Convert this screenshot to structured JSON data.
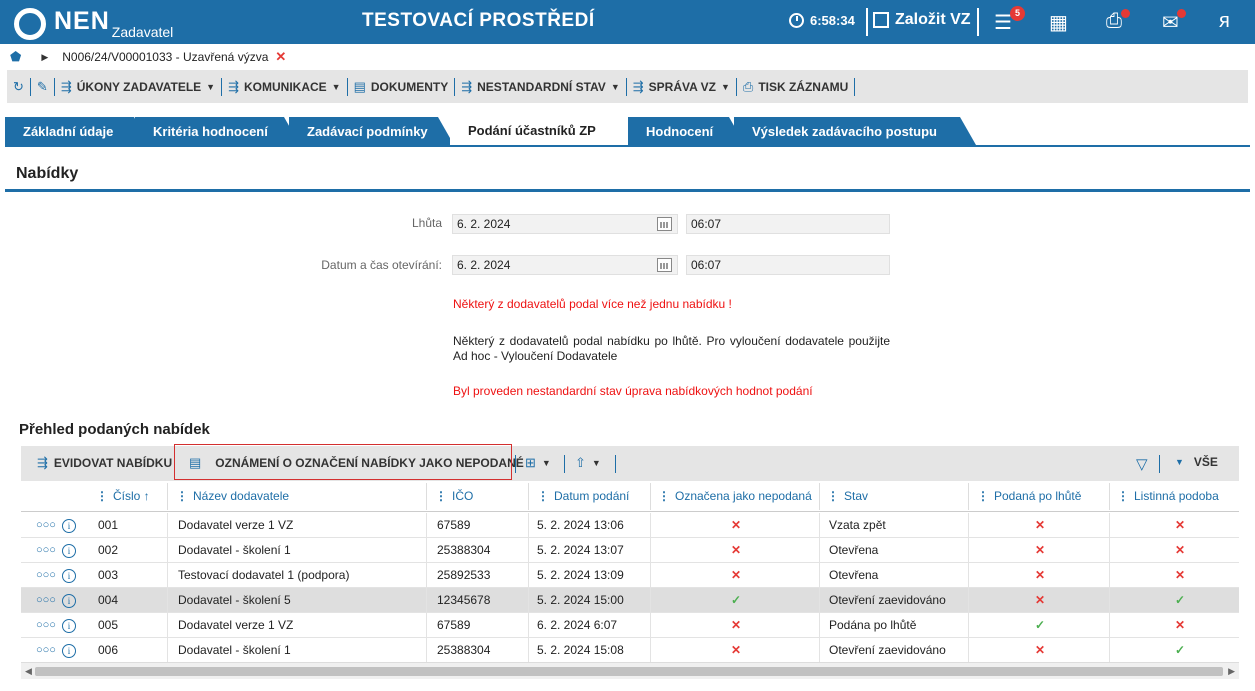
{
  "header": {
    "logo_text": "NEN",
    "logo_sub": "Zadavatel",
    "env_title": "TESTOVACÍ PROSTŘEDÍ",
    "clock": "6:58:34",
    "create_label": "Založit VZ",
    "menu_badge": "5"
  },
  "breadcrumb": {
    "path": "N006/24/V00001033 - Uzavřená výzva"
  },
  "toolbar": {
    "ukony": "ÚKONY ZADAVATELE",
    "komunikace": "KOMUNIKACE",
    "dokumenty": "DOKUMENTY",
    "nestandardni": "NESTANDARDNÍ STAV",
    "sprava": "SPRÁVA VZ",
    "tisk": "TISK ZÁZNAMU"
  },
  "tabs": [
    {
      "label": "Základní údaje"
    },
    {
      "label": "Kritéria hodnocení"
    },
    {
      "label": "Zadávací podmínky"
    },
    {
      "label": "Podání účastníků ZP"
    },
    {
      "label": "Hodnocení"
    },
    {
      "label": "Výsledek zadávacího postupu"
    }
  ],
  "section": {
    "title": "Nabídky",
    "lhuta_label": "Lhůta",
    "lhuta_date": "6. 2. 2024",
    "lhuta_time": "06:07",
    "otevreni_label": "Datum a čas otevírání:",
    "otevreni_date": "6. 2. 2024",
    "otevreni_time": "06:07",
    "msg1": "Některý z dodavatelů podal více než jednu nabídku !",
    "msg2": "Některý z dodavatelů podal nabídku po lhůtě. Pro vyloučení dodavatele použijte Ad hoc - Vyloučení Dodavatele",
    "msg3": "Byl proveden nestandardní stav úprava nabídkových hodnot podání"
  },
  "grid": {
    "title": "Přehled podaných nabídek",
    "evidovat": "EVIDOVAT NABÍDKU",
    "oznameni": "OZNÁMENÍ O OZNAČENÍ NABÍDKY JAKO NEPODANÉ",
    "vse": "VŠE",
    "columns": [
      "Číslo",
      "Název dodavatele",
      "IČO",
      "Datum podání",
      "Označena jako nepodaná",
      "Stav",
      "Podaná po lhůtě",
      "Listinná podoba"
    ],
    "rows": [
      {
        "cislo": "001",
        "nazev": "Dodavatel verze 1 VZ",
        "ico": "67589",
        "datum": "5. 2. 2024 13:06",
        "nepodana": "x",
        "stav": "Vzata zpět",
        "po_lhute": "x",
        "listinna": "x"
      },
      {
        "cislo": "002",
        "nazev": "Dodavatel - školení 1",
        "ico": "25388304",
        "datum": "5. 2. 2024 13:07",
        "nepodana": "x",
        "stav": "Otevřena",
        "po_lhute": "x",
        "listinna": "x"
      },
      {
        "cislo": "003",
        "nazev": "Testovací dodavatel 1 (podpora)",
        "ico": "25892533",
        "datum": "5. 2. 2024 13:09",
        "nepodana": "x",
        "stav": "Otevřena",
        "po_lhute": "x",
        "listinna": "x"
      },
      {
        "cislo": "004",
        "nazev": "Dodavatel - školení 5",
        "ico": "12345678",
        "datum": "5. 2. 2024 15:00",
        "nepodana": "check",
        "stav": "Otevření zaevidováno",
        "po_lhute": "x",
        "listinna": "check"
      },
      {
        "cislo": "005",
        "nazev": "Dodavatel verze 1 VZ",
        "ico": "67589",
        "datum": "6. 2. 2024 6:07",
        "nepodana": "x",
        "stav": "Podána po lhůtě",
        "po_lhute": "check",
        "listinna": "x"
      },
      {
        "cislo": "006",
        "nazev": "Dodavatel - školení 1",
        "ico": "25388304",
        "datum": "5. 2. 2024 15:08",
        "nepodana": "x",
        "stav": "Otevření zaevidováno",
        "po_lhute": "x",
        "listinna": "check"
      }
    ]
  },
  "colors": {
    "brand": "#1e6ea7",
    "error": "#e53935",
    "ok": "#4caf50"
  }
}
